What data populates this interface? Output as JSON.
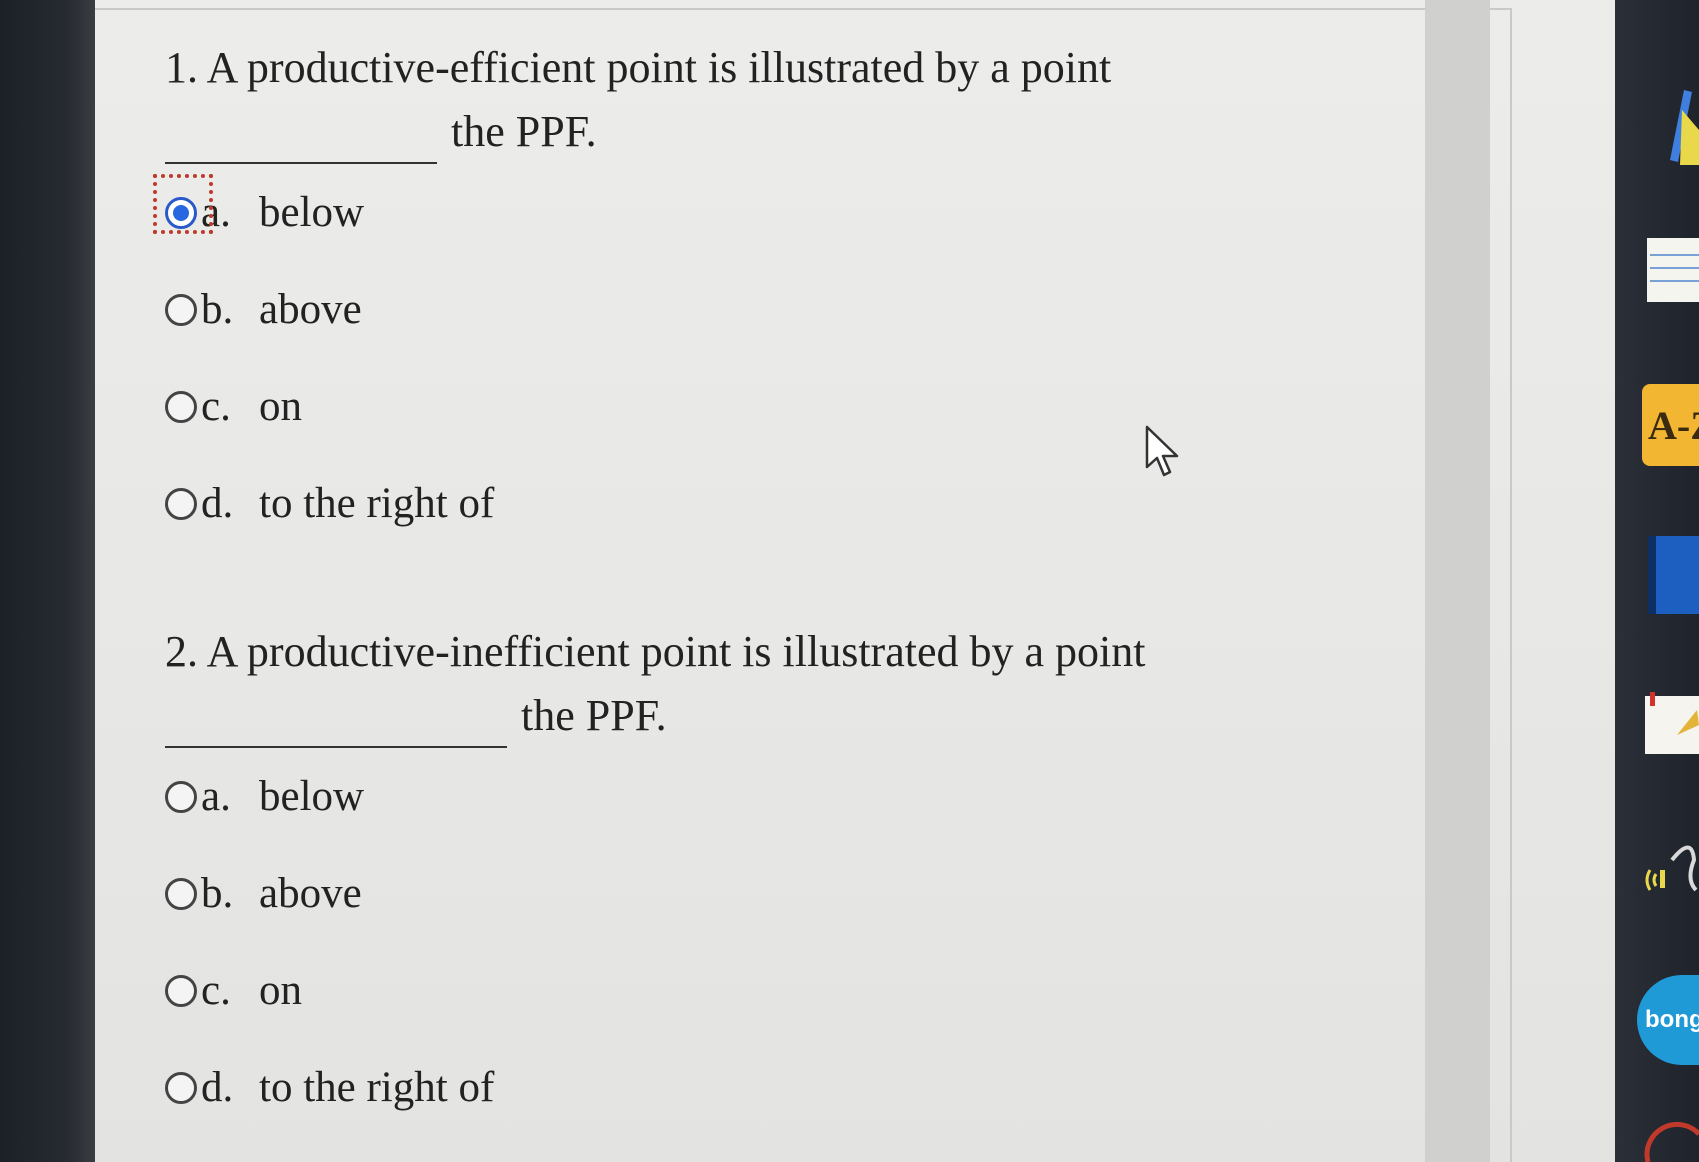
{
  "questions": [
    {
      "number": "1.",
      "text": "A productive-efficient point is illustrated by a point",
      "suffix": "the PPF.",
      "options": [
        {
          "letter": "a.",
          "label": "below",
          "selected": true
        },
        {
          "letter": "b.",
          "label": "above",
          "selected": false
        },
        {
          "letter": "c.",
          "label": "on",
          "selected": false
        },
        {
          "letter": "d.",
          "label": "to the right of",
          "selected": false
        }
      ]
    },
    {
      "number": "2.",
      "text": "A productive-inefficient point is illustrated by a point",
      "suffix": "the PPF.",
      "options": [
        {
          "letter": "a.",
          "label": "below",
          "selected": false
        },
        {
          "letter": "b.",
          "label": "above",
          "selected": false
        },
        {
          "letter": "c.",
          "label": "on",
          "selected": false
        },
        {
          "letter": "d.",
          "label": "to the right of",
          "selected": false
        }
      ]
    }
  ],
  "taskbar": {
    "az_label": "A-Z",
    "bong_label": "bong"
  },
  "colors": {
    "radio_selected": "#2767e0",
    "focus_outline": "#c0392b",
    "az_badge": "#f2b632",
    "bong_badge": "#1f9ad6"
  }
}
